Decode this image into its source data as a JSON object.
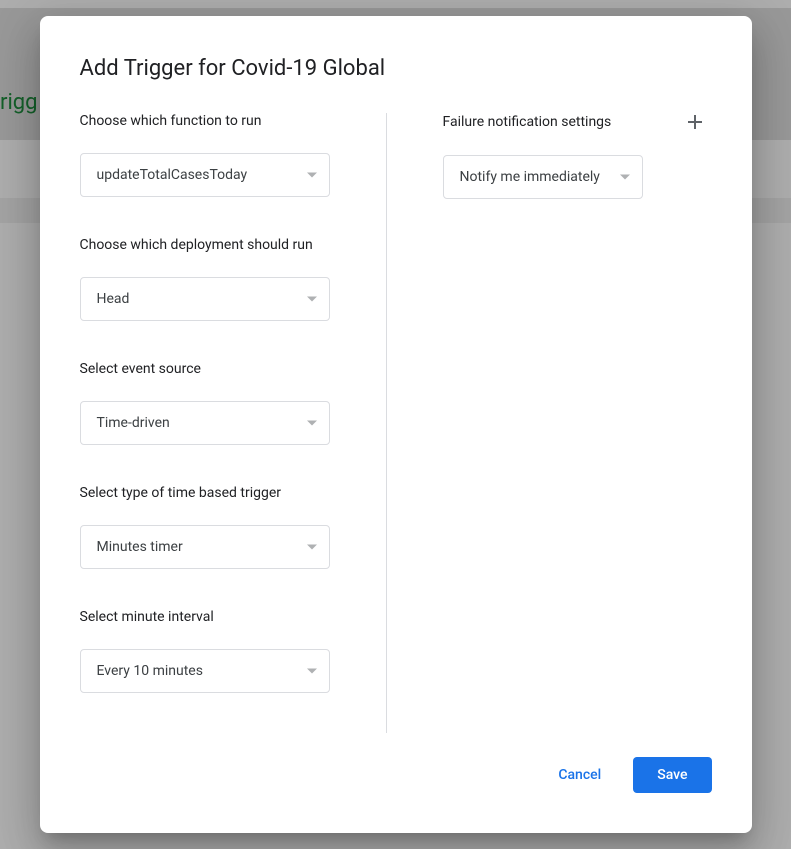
{
  "backdrop": {
    "partial_text": "rigg"
  },
  "dialog": {
    "title": "Add Trigger for Covid-19 Global",
    "left": {
      "function_label": "Choose which function to run",
      "function_value": "updateTotalCasesToday",
      "deployment_label": "Choose which deployment should run",
      "deployment_value": "Head",
      "event_source_label": "Select event source",
      "event_source_value": "Time-driven",
      "trigger_type_label": "Select type of time based trigger",
      "trigger_type_value": "Minutes timer",
      "interval_label": "Select minute interval",
      "interval_value": "Every 10 minutes"
    },
    "right": {
      "notification_label": "Failure notification settings",
      "notification_value": "Notify me immediately"
    },
    "footer": {
      "cancel": "Cancel",
      "save": "Save"
    }
  }
}
